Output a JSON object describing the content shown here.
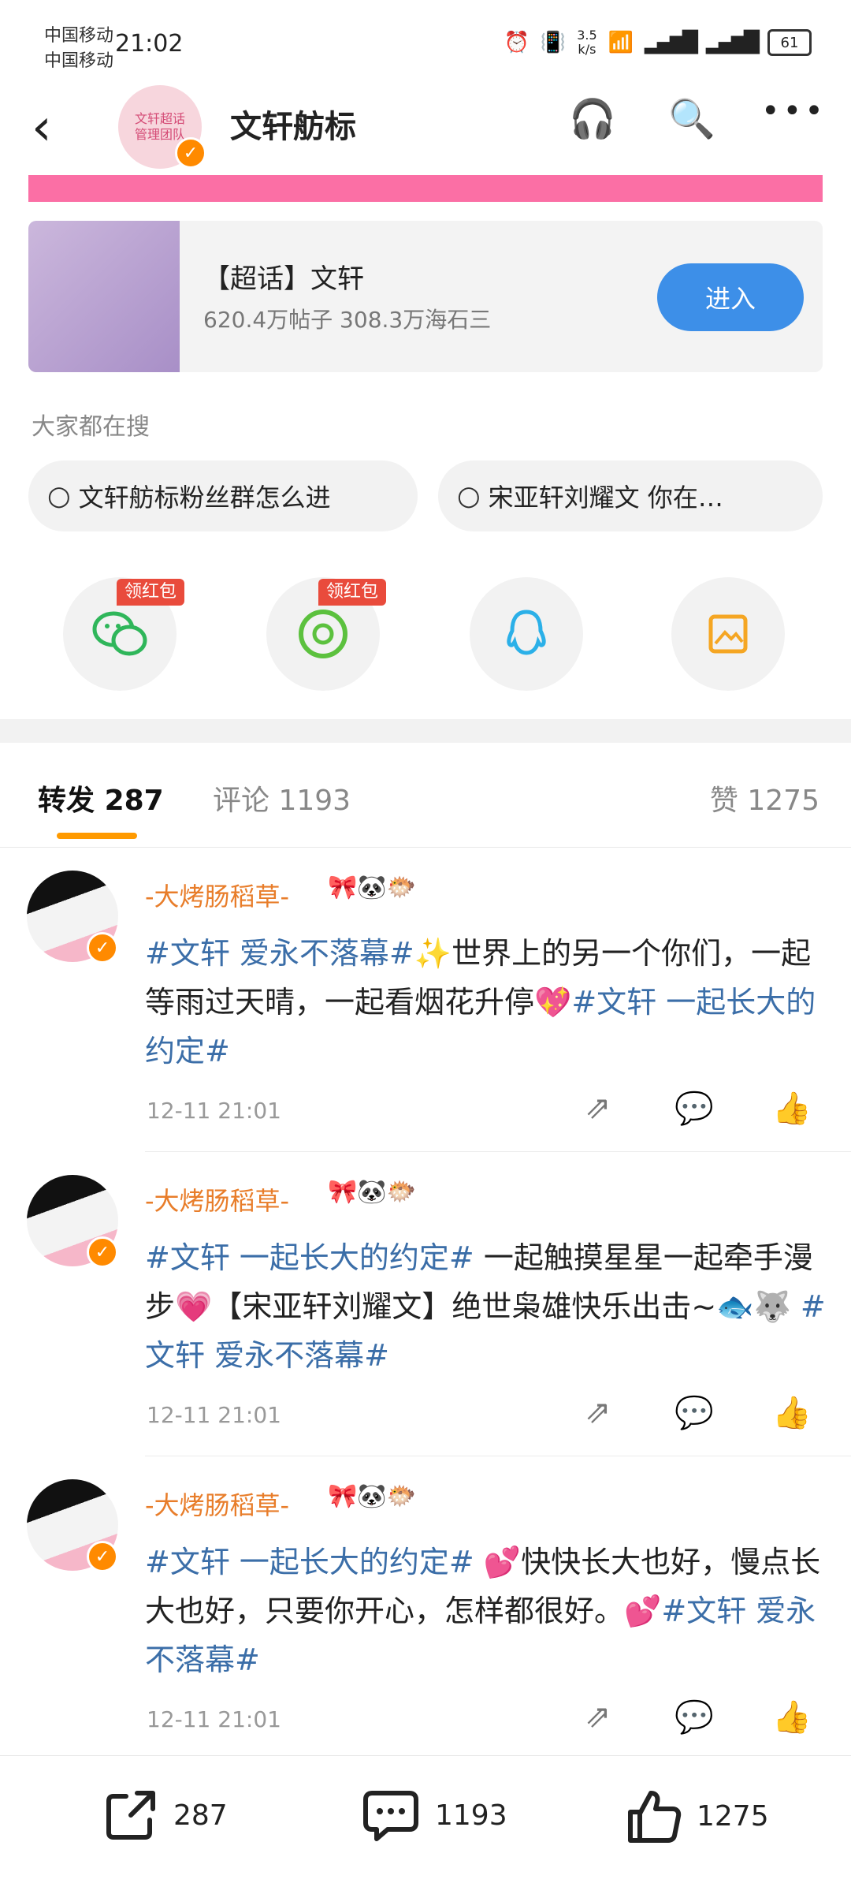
{
  "status_bar": {
    "carrier1": "中国移动",
    "carrier2": "中国移动",
    "time": "21:02",
    "net_speed": "3.5",
    "net_unit": "k/s",
    "battery": "61"
  },
  "nav": {
    "title": "文轩舫标",
    "avatar_text": "文轩超话 管理团队"
  },
  "supertopic": {
    "title": "【超话】文轩",
    "stats": "620.4万帖子 308.3万海石三",
    "enter_label": "进入"
  },
  "search": {
    "heading": "大家都在搜",
    "items": [
      "文轩舫标粉丝群怎么进",
      "宋亚轩刘耀文 你在…"
    ]
  },
  "share": {
    "tag1": "领红包",
    "tag2": "领红包"
  },
  "tabs": {
    "repost_label": "转发",
    "repost_count": "287",
    "comment_label": "评论",
    "comment_count": "1193",
    "like_label": "赞",
    "like_count": "1275"
  },
  "posts": [
    {
      "user": "-大烤肠稻草-",
      "tag1": "#文轩 爱永不落幕#",
      "text": "✨世界上的另一个你们，一起等雨过天晴，一起看烟花升停💖",
      "tag2": "#文轩 一起长大的约定#",
      "time": "12-11 21:01"
    },
    {
      "user": "-大烤肠稻草-",
      "tag1": "#文轩 一起长大的约定#",
      "text": " 一起触摸星星一起牵手漫步💗【宋亚轩刘耀文】绝世枭雄快乐出击~🐟🐺 ",
      "tag2": "#文轩 爱永不落幕#",
      "time": "12-11 21:01"
    },
    {
      "user": "-大烤肠稻草-",
      "tag1": "#文轩 一起长大的约定#",
      "text": " 💕快快长大也好，慢点长大也好，只要你开心，怎样都很好。💕",
      "tag2": "#文轩 爱永不落幕#",
      "time": "12-11 21:01"
    }
  ],
  "bottom_bar": {
    "repost": "287",
    "comment": "1193",
    "like": "1275"
  }
}
